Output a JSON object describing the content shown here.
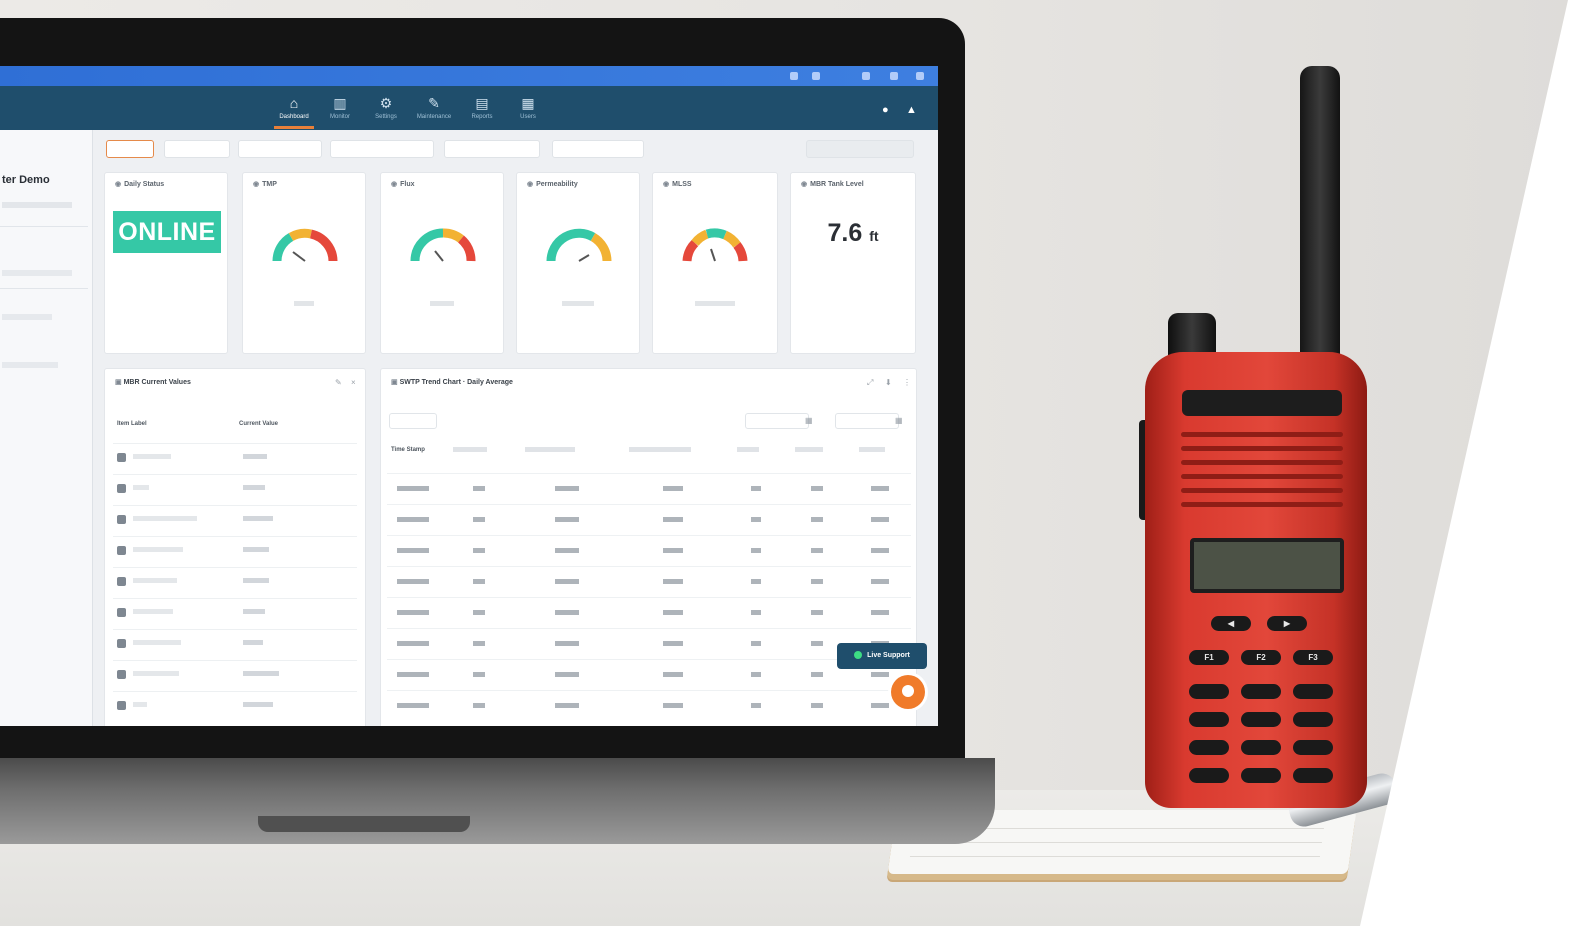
{
  "app": {
    "nav": [
      {
        "label": "Dashboard",
        "icon": "home-icon",
        "active": true
      },
      {
        "label": "Monitor",
        "icon": "chart-icon",
        "active": false
      },
      {
        "label": "Settings",
        "icon": "gear-icon",
        "active": false
      },
      {
        "label": "Maintenance",
        "icon": "wrench-icon",
        "active": false
      },
      {
        "label": "Reports",
        "icon": "report-icon",
        "active": false
      },
      {
        "label": "Users",
        "icon": "users-icon",
        "active": false
      }
    ],
    "sidebar": {
      "title": "ter Demo"
    }
  },
  "dashboard": {
    "status_card": {
      "title": "Daily Status",
      "value": "ONLINE"
    },
    "gauges": [
      {
        "title": "TMP"
      },
      {
        "title": "Flux"
      },
      {
        "title": "Permeability"
      },
      {
        "title": "MLSS"
      }
    ],
    "tank_card": {
      "title": "MBR Tank Level",
      "value": "7.6",
      "unit": "ft"
    },
    "current_values_panel": {
      "title": "MBR Current Values",
      "headers": [
        "Item Label",
        "Current Value"
      ]
    },
    "daily_panel": {
      "title": "SWTP Trend Chart · Daily Average",
      "headers": [
        "Time Stamp"
      ]
    },
    "live_support_label": "Live Support"
  },
  "colors": {
    "app_bar": "#1f4e6c",
    "title_bar": "#2f6fd6",
    "online_green": "#35c8a6",
    "accent_orange": "#f07b2a",
    "radio_red": "#e2473a"
  },
  "radio": {
    "keys": {
      "function_row": [
        "F1",
        "F2",
        "F3"
      ]
    }
  }
}
